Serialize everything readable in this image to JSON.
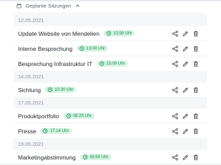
{
  "header": {
    "label": "Geplante Sitzungen"
  },
  "groups": [
    {
      "date": "12.05.2021",
      "items": [
        {
          "title": "Update Website von Mendelien",
          "time": "10:59 Uhr"
        },
        {
          "title": "Interne Besprechung",
          "time": "13:00 Uhr"
        },
        {
          "title": "Besprechung Infrastruktur IT",
          "time": "15:00 Uhr"
        }
      ]
    },
    {
      "date": "14.05.2021",
      "items": [
        {
          "title": "Sichtung",
          "time": "10:30 Uhr"
        }
      ]
    },
    {
      "date": "17.05.2021",
      "items": [
        {
          "title": "Produktportfolio",
          "time": "08:25 Uhr"
        },
        {
          "title": "Presse",
          "time": "17:14 Uhr"
        }
      ]
    },
    {
      "date": "19.05.2021",
      "items": [
        {
          "title": "Marketingabstimmung",
          "time": "08:55 Uhr"
        }
      ]
    }
  ],
  "colors": {
    "badge_bg": "#d6f3e3",
    "badge_text": "#138a4a",
    "date_bg": "#f5f6f8"
  },
  "icons": {
    "calendar": "calendar-icon",
    "chevron": "chevron-up-icon",
    "clock": "clock-icon",
    "share": "share-icon",
    "edit": "pencil-icon",
    "delete": "trash-icon"
  }
}
